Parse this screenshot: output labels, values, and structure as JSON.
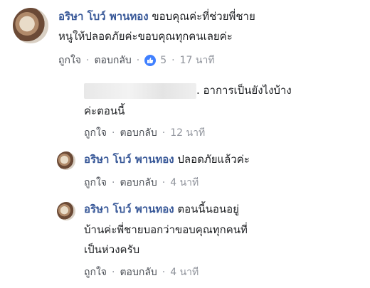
{
  "comments": [
    {
      "author": "อริษา โบว์ พานทอง",
      "text_line1": " ขอบคุณค่ะที่ช่วยพี่ชาย",
      "text_line2": "หนูให้ปลอดภัยค่ะขอบคุณทุกคนเลยค่ะ",
      "like": "ถูกใจ",
      "reply": "ตอบกลับ",
      "reaction_count": "5",
      "time": "17 นาที",
      "reaction_icon": "like-thumb-icon",
      "reaction_color": "#4080ff"
    },
    {
      "author_obscured": true,
      "text_line1": ". อาการเป็นยังไงบ้าง",
      "text_line2": "ค่ะตอนนี้",
      "like": "ถูกใจ",
      "reply": "ตอบกลับ",
      "time": "12 นาที"
    },
    {
      "author": "อริษา โบว์ พานทอง",
      "text_line1": " ปลอดภัยแล้วค่ะ",
      "like": "ถูกใจ",
      "reply": "ตอบกลับ",
      "time": "4 นาที"
    },
    {
      "author": "อริษา โบว์ พานทอง",
      "text_line1": " ตอนนี้นอนอยู่",
      "text_line2": "บ้านค่ะพี่ชายบอกว่าขอบคุณทุกคนที่",
      "text_line3": "เป็นห่วงครับ",
      "like": "ถูกใจ",
      "reply": "ตอบกลับ",
      "time": "4 นาที"
    }
  ],
  "colors": {
    "name": "#385898",
    "meta": "#90949c",
    "text": "#1c1e21"
  }
}
